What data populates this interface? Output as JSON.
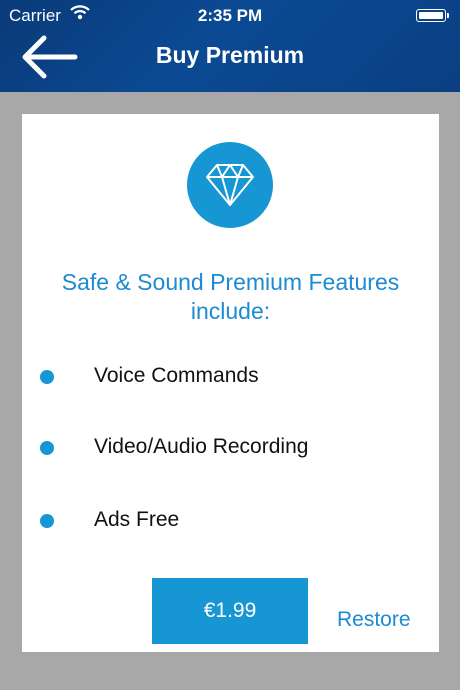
{
  "status_bar": {
    "carrier": "Carrier",
    "time": "2:35 PM"
  },
  "nav": {
    "title": "Buy Premium",
    "back_icon": "arrow-left-icon"
  },
  "card": {
    "icon": "diamond-icon",
    "heading_line1": "Safe & Sound Premium Features",
    "heading_line2": "include:",
    "features": [
      {
        "label": "Voice Commands"
      },
      {
        "label": "Video/Audio Recording"
      },
      {
        "label": "Ads Free"
      }
    ],
    "price_label": "€1.99",
    "restore_label": "Restore"
  },
  "colors": {
    "nav_background": "#0b4a93",
    "accent": "#1696d2",
    "heading_text": "#1d8ad1",
    "page_background": "#a8a8a8"
  }
}
